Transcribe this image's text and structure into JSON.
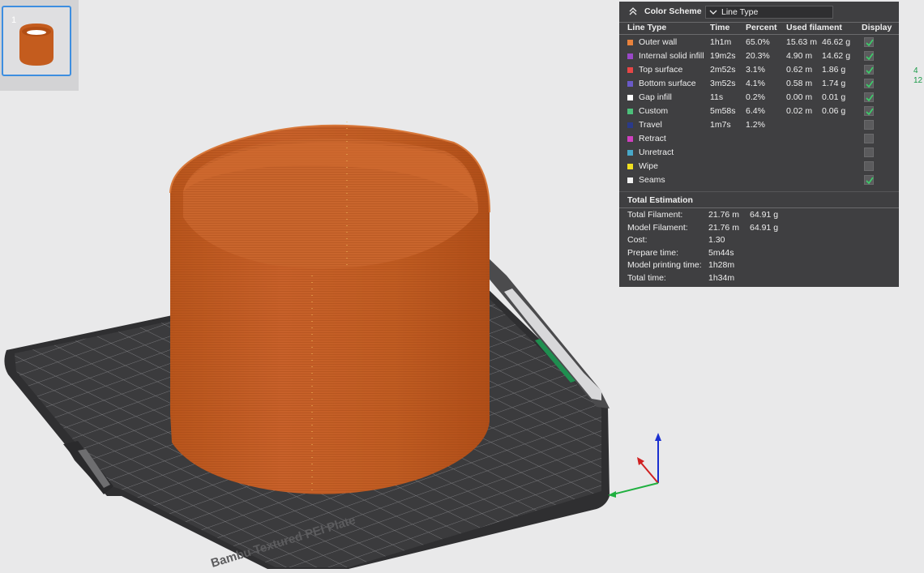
{
  "plate": {
    "number": "1",
    "text": "Bambu Textured PEI Plate"
  },
  "side_stats": [
    "4",
    "12"
  ],
  "legend": {
    "title": "Color Scheme",
    "scheme_value": "Line Type",
    "headers": {
      "line_type": "Line Type",
      "time": "Time",
      "percent": "Percent",
      "used_filament": "Used filament",
      "display": "Display"
    },
    "rows": [
      {
        "name": "Outer wall",
        "color": "#e8823c",
        "time": "1h1m",
        "percent": "65.0%",
        "length": "15.63 m",
        "weight": "46.62 g",
        "display": true
      },
      {
        "name": "Internal solid infill",
        "color": "#9a48c8",
        "time": "19m2s",
        "percent": "20.3%",
        "length": "4.90 m",
        "weight": "14.62 g",
        "display": true
      },
      {
        "name": "Top surface",
        "color": "#e84646",
        "time": "2m52s",
        "percent": "3.1%",
        "length": "0.62 m",
        "weight": "1.86 g",
        "display": true
      },
      {
        "name": "Bottom surface",
        "color": "#6a5ac8",
        "time": "3m52s",
        "percent": "4.1%",
        "length": "0.58 m",
        "weight": "1.74 g",
        "display": true
      },
      {
        "name": "Gap infill",
        "color": "#ffffff",
        "time": "11s",
        "percent": "0.2%",
        "length": "0.00 m",
        "weight": "0.01 g",
        "display": true
      },
      {
        "name": "Custom",
        "color": "#4cc07a",
        "time": "5m58s",
        "percent": "6.4%",
        "length": "0.02 m",
        "weight": "0.06 g",
        "display": true
      },
      {
        "name": "Travel",
        "color": "#2a3a8a",
        "time": "1m7s",
        "percent": "1.2%",
        "length": "",
        "weight": "",
        "display": false
      },
      {
        "name": "Retract",
        "color": "#d040c0",
        "time": "",
        "percent": "",
        "length": "",
        "weight": "",
        "display": false
      },
      {
        "name": "Unretract",
        "color": "#48a8c8",
        "time": "",
        "percent": "",
        "length": "",
        "weight": "",
        "display": false
      },
      {
        "name": "Wipe",
        "color": "#f0e020",
        "time": "",
        "percent": "",
        "length": "",
        "weight": "",
        "display": false
      },
      {
        "name": "Seams",
        "color": "#f2f2f2",
        "time": "",
        "percent": "",
        "length": "",
        "weight": "",
        "display": true
      }
    ],
    "total_title": "Total Estimation",
    "totals": [
      {
        "label": "Total Filament:",
        "value": "21.76 m",
        "value2": "64.91 g"
      },
      {
        "label": "Model Filament:",
        "value": "21.76 m",
        "value2": "64.91 g"
      },
      {
        "label": "Cost:",
        "value": "1.30",
        "value2": ""
      },
      {
        "label": "Prepare time:",
        "value": "5m44s",
        "value2": ""
      },
      {
        "label": "Model printing time:",
        "value": "1h28m",
        "value2": ""
      },
      {
        "label": "Total time:",
        "value": "1h34m",
        "value2": ""
      }
    ]
  }
}
